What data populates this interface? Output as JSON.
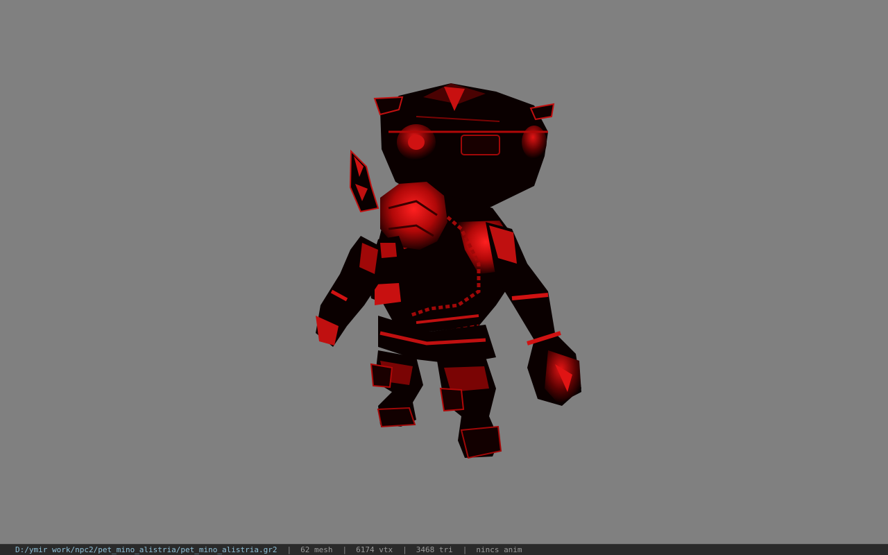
{
  "viewer": {
    "background_color": "#808080",
    "model_name": "pet_mino_alistria",
    "model_colors": {
      "shadow": "#080000",
      "highlight": "#e01010",
      "mid": "#9a0606"
    }
  },
  "statusbar": {
    "file_path": "D:/ymir work/npc2/pet_mino_alistria/pet_mino_alistria.gr2",
    "separator": "|",
    "mesh": "62 mesh",
    "vtx": "6174 vtx",
    "tri": "3468 tri",
    "anim": "nincs anim"
  }
}
